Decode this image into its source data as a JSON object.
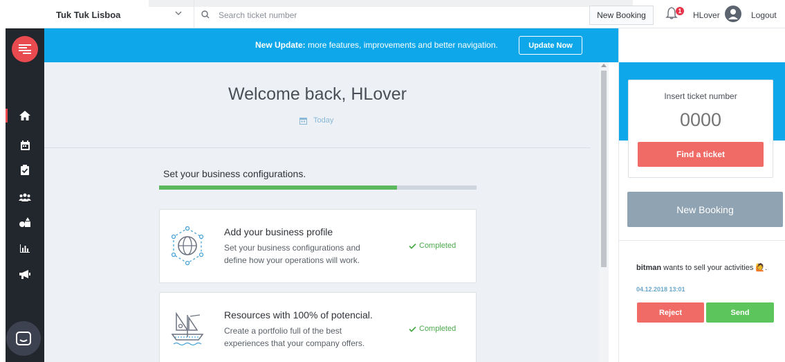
{
  "header": {
    "company": "Tuk Tuk Lisboa",
    "search_placeholder": "Search ticket number",
    "new_booking_label": "New Booking",
    "notification_count": "1",
    "username": "HLover",
    "logout_label": "Logout"
  },
  "banner": {
    "bold_text": "New Update:",
    "text": " more features, improvements and better navigation.",
    "button_label": "Update Now"
  },
  "sidebar": {
    "items": [
      {
        "icon": "home-icon",
        "active": true
      },
      {
        "icon": "calendar-icon"
      },
      {
        "icon": "clipboard-check-icon"
      },
      {
        "icon": "users-icon"
      },
      {
        "icon": "shapes-icon"
      },
      {
        "icon": "bar-chart-icon"
      },
      {
        "icon": "megaphone-icon"
      }
    ],
    "accent_color": "#e84a4f"
  },
  "main": {
    "welcome": "Welcome back, HLover",
    "date_label": "Today",
    "config_title": "Set your business configurations.",
    "progress_fraction": 0.75,
    "cards": [
      {
        "title": "Add your business profile",
        "description": "Set your business configurations and define how your operations will work.",
        "status": "Completed",
        "icon": "globe-network-icon"
      },
      {
        "title": "Resources with 100% of potencial.",
        "description": "Create a portfolio full of the best experiences that your company offers.",
        "status": "Completed",
        "icon": "sailboat-icon"
      }
    ]
  },
  "ticket": {
    "label": "Insert ticket number",
    "placeholder": "0000",
    "button_label": "Find a ticket"
  },
  "right": {
    "new_booking_label": "New Booking",
    "notification": {
      "user": "bitman",
      "text": " wants to sell your activities",
      "emoji": "🙋",
      "timestamp": "04.12.2018 13:01",
      "reject_label": "Reject",
      "send_label": "Send"
    }
  },
  "colors": {
    "banner": "#0ea7e9",
    "progress": "#5cb85c",
    "danger": "#f06a66",
    "success": "#5cc65c"
  }
}
